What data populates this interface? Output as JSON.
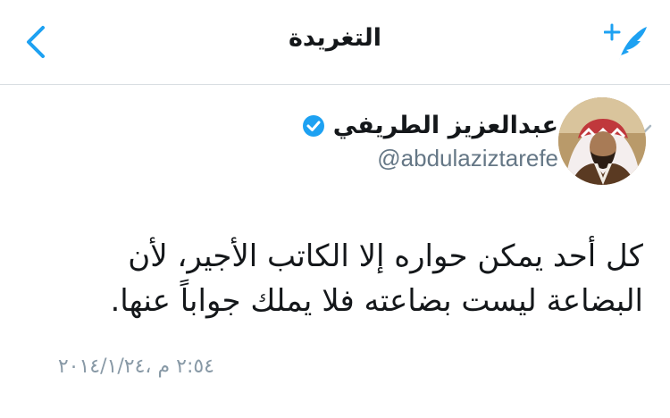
{
  "nav": {
    "title": "التغريدة",
    "back_icon": "chevron-left-icon",
    "compose_icon": "compose-tweet-icon"
  },
  "tweet": {
    "author_name": "عبدالعزيز الطريفي",
    "verified_icon": "verified-badge-icon",
    "handle": "@abdulaziztarefe",
    "text": "كل أحد يمكن حواره إلا الكاتب الأجير، لأن البضاعة ليست بضاعته فلا يملك جواباً عنها.",
    "timestamp": "٢:٥٤ م ،٢٠١٤/١/٢٤",
    "menu_icon": "chevron-down-icon"
  },
  "colors": {
    "accent": "#1da1f2",
    "text": "#14171a",
    "secondary_text": "#657786",
    "timestamp": "#8899a6",
    "divider": "#d8dde1"
  }
}
